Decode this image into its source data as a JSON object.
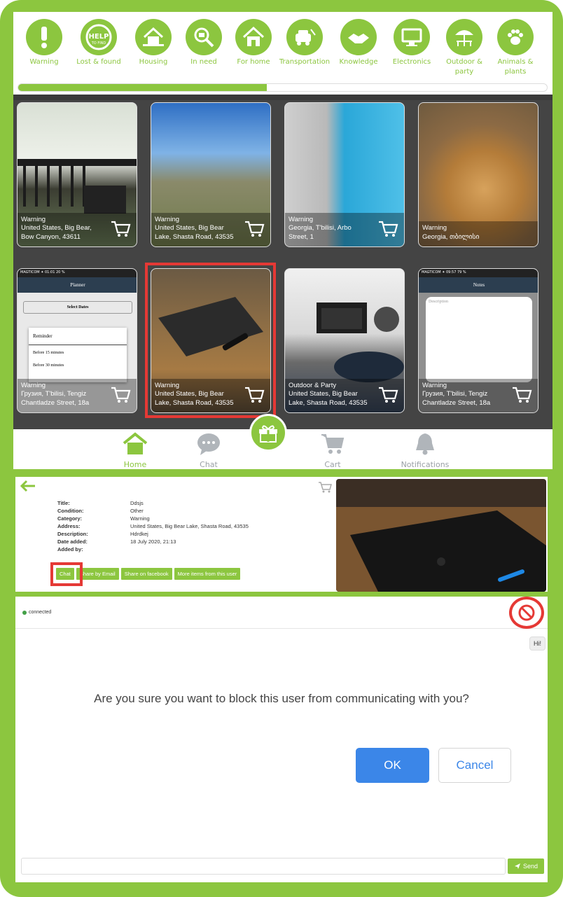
{
  "colors": {
    "accent": "#8cc63f",
    "highlight": "#e53935",
    "ok_blue": "#3b86e8"
  },
  "categories": [
    {
      "label": "Warning",
      "icon": "warning-icon"
    },
    {
      "label": "Lost & found",
      "icon": "help-to-find-icon"
    },
    {
      "label": "Housing",
      "icon": "housing-icon"
    },
    {
      "label": "In need",
      "icon": "in-need-icon"
    },
    {
      "label": "For home",
      "icon": "for-home-icon"
    },
    {
      "label": "Transportation",
      "icon": "transportation-icon"
    },
    {
      "label": "Knowledge",
      "icon": "knowledge-icon"
    },
    {
      "label": "Electronics",
      "icon": "electronics-icon"
    },
    {
      "label": "Outdoor & party",
      "icon": "outdoor-party-icon"
    },
    {
      "label": "Animals & plants",
      "icon": "animals-plants-icon"
    }
  ],
  "progress": 0.47,
  "listings": [
    {
      "category": "Warning",
      "location": "United States, Big Bear, Bow Canyon, 43611"
    },
    {
      "category": "Warning",
      "location": "United States, Big Bear Lake, Shasta Road, 43535"
    },
    {
      "category": "Warning",
      "location": "Georgia, T'bilisi, Arbo Street, 1"
    },
    {
      "category": "Warning",
      "location": "Georgia, თბილისი"
    },
    {
      "category": "Warning",
      "location": "Грузия, T'bilisi, Tengiz Chantladze Street, 18a"
    },
    {
      "category": "Warning",
      "location": "United States, Big Bear Lake, Shasta Road, 43535"
    },
    {
      "category": "Outdoor & Party",
      "location": "United States, Big Bear Lake, Shasta Road, 43535"
    },
    {
      "category": "Warning",
      "location": "Грузия, T'bilisi, Tengiz Chantladze Street, 18a"
    }
  ],
  "planner": {
    "title": "Planner",
    "select_dates": "Select Dates",
    "reminder": "Reminder",
    "options": [
      "Before 15 minutes",
      "Before 30 minutes"
    ],
    "extra": "45 minutes"
  },
  "notes": {
    "title": "Notes",
    "placeholder": "Description"
  },
  "nav": {
    "home": "Home",
    "chat": "Chat",
    "cart": "Cart",
    "notifications": "Notifications"
  },
  "details": {
    "rows": [
      {
        "k": "Title:",
        "v": "Ddsjs"
      },
      {
        "k": "Condition:",
        "v": "Other"
      },
      {
        "k": "Category:",
        "v": "Warning"
      },
      {
        "k": "Address:",
        "v": "United States, Big Bear Lake, Shasta Road, 43535"
      },
      {
        "k": "Description:",
        "v": "Hdrdkej"
      },
      {
        "k": "Date added:",
        "v": "18 July 2020, 21:13"
      },
      {
        "k": "Added by:",
        "v": ""
      }
    ],
    "buttons": {
      "chat": "Chat",
      "email": "Share by Email",
      "facebook": "Share on facebook",
      "more": "More items from this user"
    }
  },
  "chat": {
    "status": "connected",
    "message": "Hi!",
    "confirm_text": "Are you sure you want to block this user from communicating with you?",
    "ok": "OK",
    "cancel": "Cancel",
    "send": "Send"
  }
}
